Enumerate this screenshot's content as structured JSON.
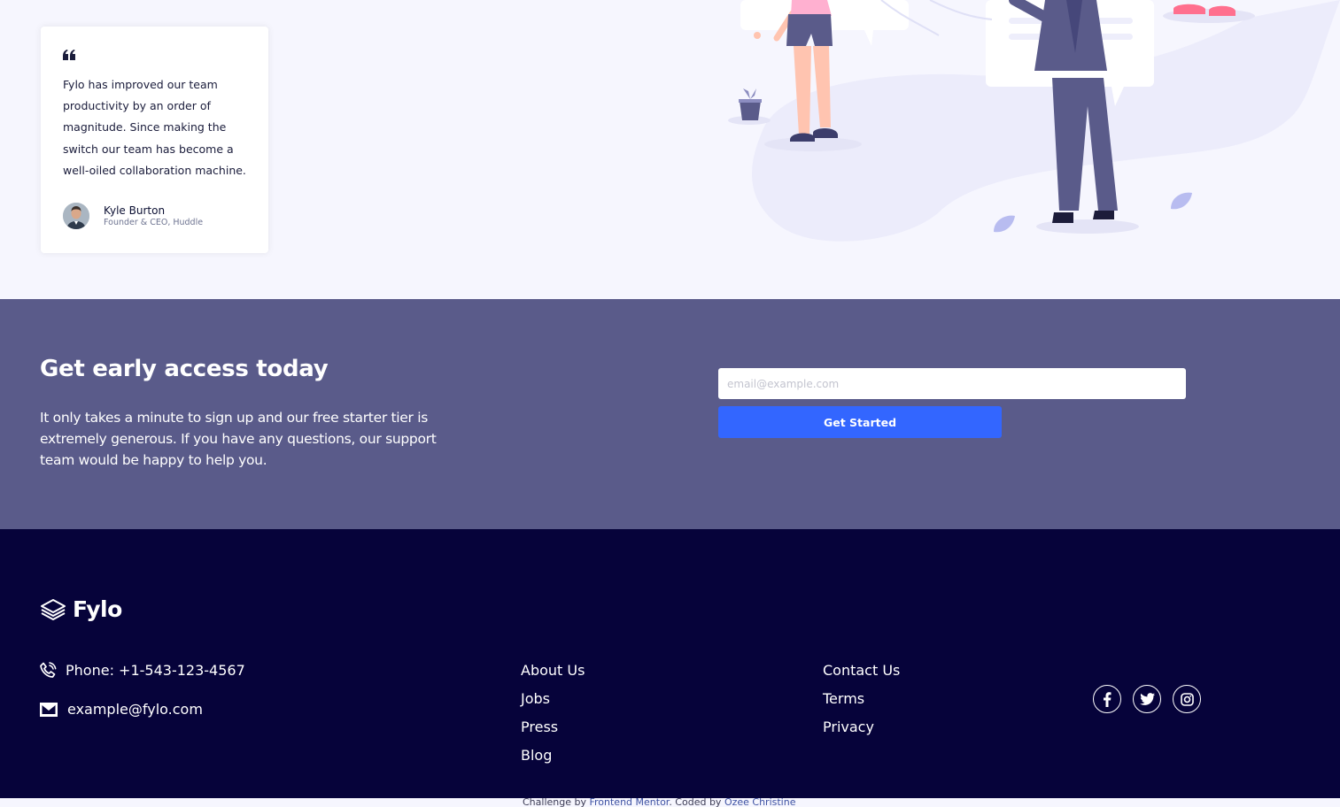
{
  "testimonial": {
    "quote": "Fylo has improved our team productivity by an order of magnitude. Since making the switch our team has become a well-oiled collaboration machine.",
    "author_name": "Kyle Burton",
    "author_title": "Founder & CEO, Huddle"
  },
  "access": {
    "title": "Get early access today",
    "description": "It only takes a minute to sign up and our free starter tier is extremely generous. If you have any questions, our support team would be happy to help you.",
    "email_placeholder": "email@example.com",
    "button_label": "Get Started"
  },
  "footer": {
    "logo_text": "Fylo",
    "phone": "Phone: +1-543-123-4567",
    "email": "example@fylo.com",
    "links_col1": [
      "About Us",
      "Jobs",
      "Press",
      "Blog"
    ],
    "links_col2": [
      "Contact Us",
      "Terms",
      "Privacy"
    ],
    "socials": [
      {
        "icon": "facebook-icon"
      },
      {
        "icon": "twitter-icon"
      },
      {
        "icon": "instagram-icon"
      }
    ]
  },
  "attribution": {
    "prefix": "Challenge by ",
    "link1": "Frontend Mentor",
    "middle": ". Coded by ",
    "link2": "Ozee Christine"
  },
  "colors": {
    "page_bg": "#f6f6fe",
    "access_bg": "#5a5b8a",
    "footer_bg": "#06033a",
    "button": "#3366ff"
  }
}
